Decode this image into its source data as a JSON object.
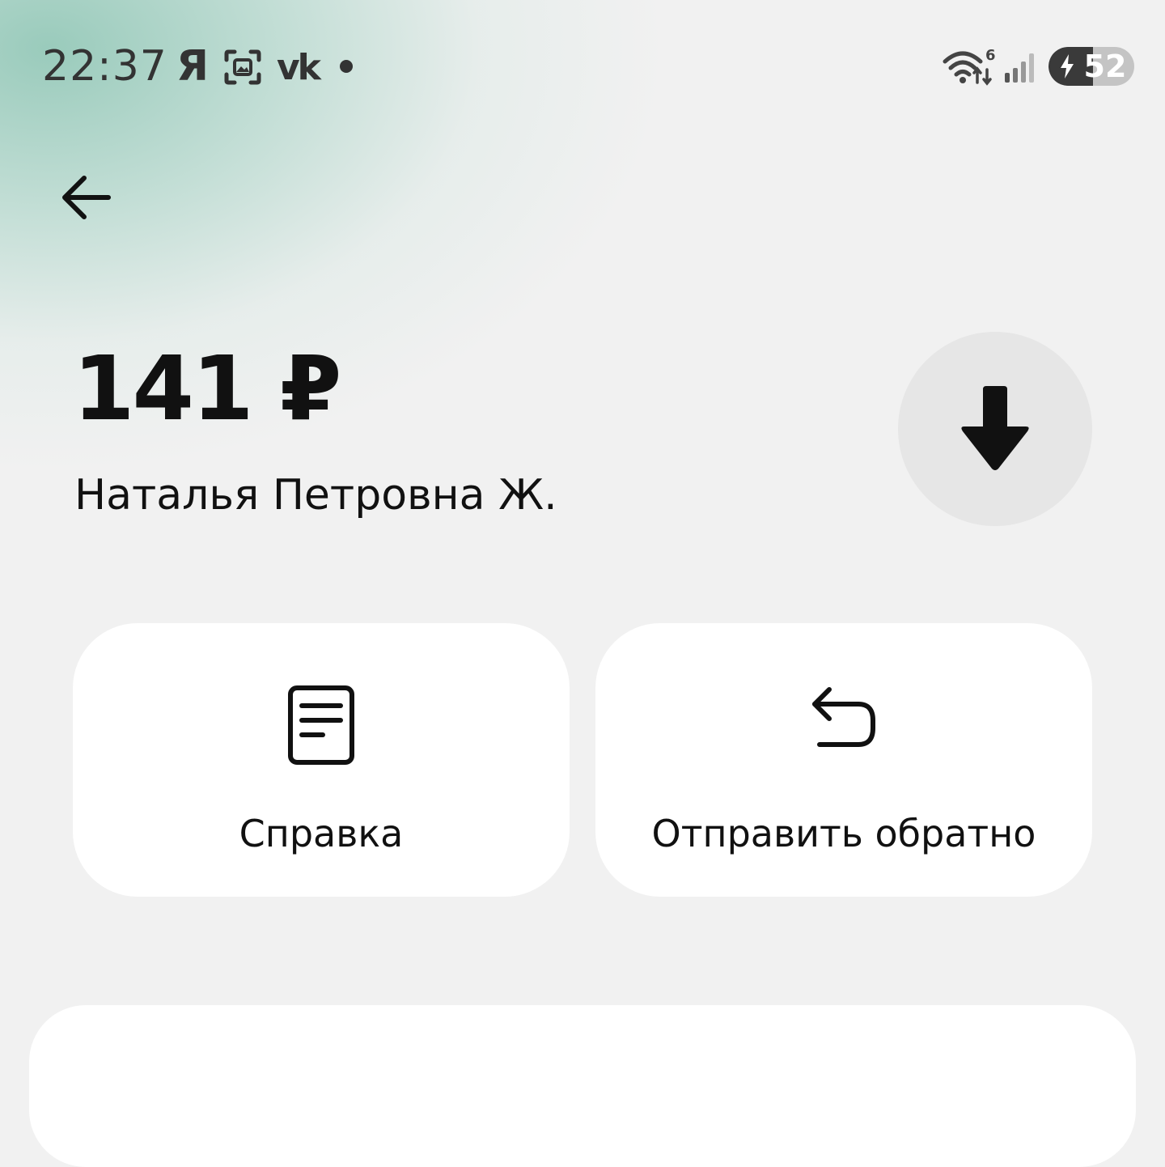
{
  "status_bar": {
    "time": "22:37",
    "yandex_icon_text": "Я",
    "vk_icon_text": "vk",
    "wifi_badge": "6",
    "battery_level": "52",
    "battery_fraction": 0.52
  },
  "header": {
    "back_icon": "arrow-left-icon"
  },
  "transaction": {
    "amount": "141 ₽",
    "recipient": "Наталья Петровна Ж.",
    "direction_icon": "arrow-down-icon"
  },
  "actions": [
    {
      "label": "Справка",
      "icon": "document-icon"
    },
    {
      "label": "Отправить обратно",
      "icon": "return-arrow-icon"
    }
  ],
  "colors": {
    "background": "#f1f1f1",
    "accent_gradient": "#8ac4b2",
    "card": "#ffffff",
    "badge": "#e6e6e6"
  }
}
